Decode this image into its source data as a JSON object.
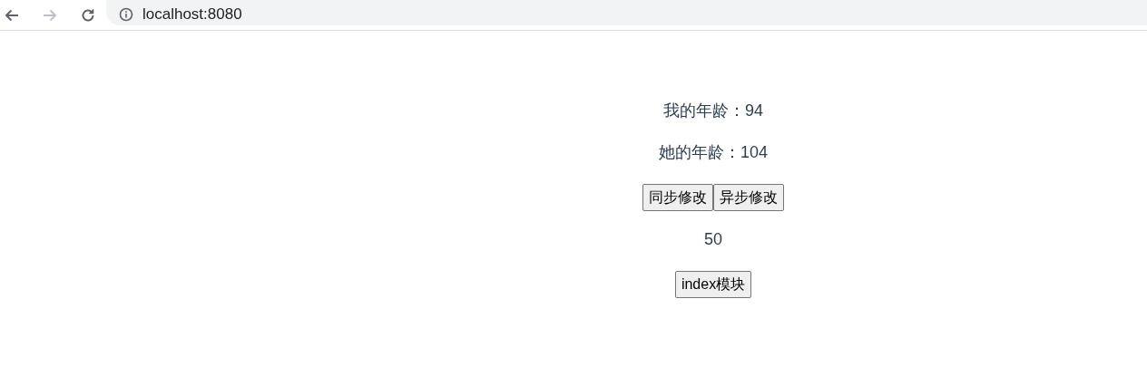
{
  "browser": {
    "nav_buttons": [
      {
        "kind": "back",
        "disabled": false
      },
      {
        "kind": "forward",
        "disabled": true
      },
      {
        "kind": "reload",
        "disabled": false
      }
    ],
    "address": "localhost:8080"
  },
  "page": {
    "blocks": [
      {
        "kind": "text",
        "text": "我的年龄：94"
      },
      {
        "kind": "text",
        "text": "她的年龄：104"
      },
      {
        "kind": "buttons",
        "buttons": [
          "同步修改",
          "异步修改"
        ]
      },
      {
        "kind": "text",
        "text": "50"
      },
      {
        "kind": "buttons",
        "buttons": [
          "index模块"
        ]
      }
    ]
  }
}
